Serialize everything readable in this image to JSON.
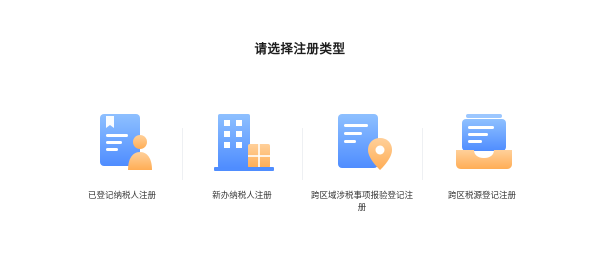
{
  "page": {
    "title": "请选择注册类型"
  },
  "options": [
    {
      "label": "已登记纳税人注册",
      "icon": "document-person-icon"
    },
    {
      "label": "新办纳税人注册",
      "icon": "building-icon"
    },
    {
      "label": "跨区域涉税事项报验登记注册",
      "icon": "document-location-icon"
    },
    {
      "label": "跨区税源登记注册",
      "icon": "inbox-document-icon"
    }
  ],
  "colors": {
    "blue_light": "#9cc7ff",
    "blue_dark": "#4f8dff",
    "orange_light": "#ffd9a3",
    "orange_dark": "#ffa94d"
  }
}
